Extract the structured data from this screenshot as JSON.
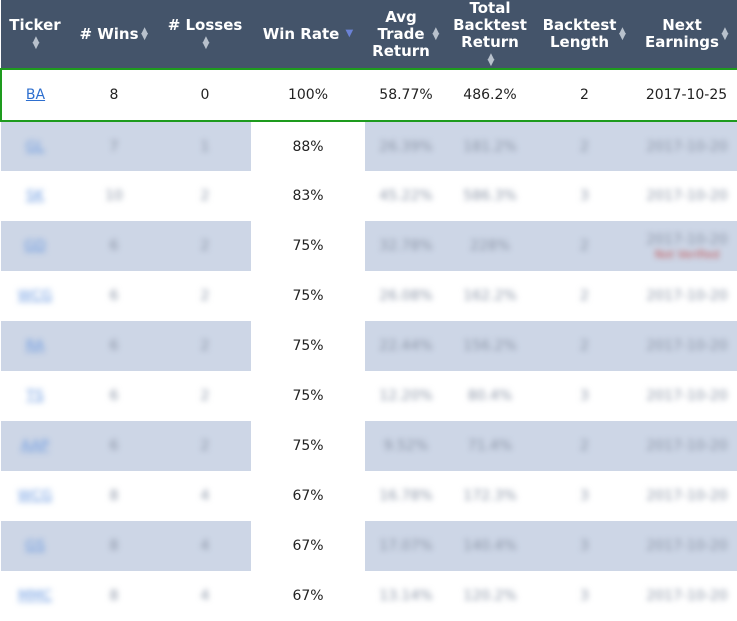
{
  "headers": [
    {
      "key": "ticker",
      "lines": [
        "Ticker"
      ]
    },
    {
      "key": "wins",
      "lines": [
        "# Wins"
      ]
    },
    {
      "key": "losses",
      "lines": [
        "# Losses"
      ]
    },
    {
      "key": "win_rate",
      "lines": [
        "Win Rate"
      ]
    },
    {
      "key": "avg_return",
      "lines": [
        "Avg",
        "Trade",
        "Return"
      ]
    },
    {
      "key": "total_return",
      "lines": [
        "Total",
        "Backtest",
        "Return"
      ]
    },
    {
      "key": "length",
      "lines": [
        "Backtest",
        "Length"
      ]
    },
    {
      "key": "earnings",
      "lines": [
        "Next",
        "Earnings"
      ]
    }
  ],
  "sort_icon": "sort-arrows-icon",
  "sorted_desc_icon": "sort-desc-triangle-icon",
  "rows": [
    {
      "ticker": "BA",
      "wins": "8",
      "losses": "0",
      "win_rate": "100%",
      "avg_return": "58.77%",
      "total_return": "486.2%",
      "length": "2",
      "earnings": "2017-10-25",
      "blurred": false
    },
    {
      "ticker": "GL",
      "wins": "7",
      "losses": "1",
      "win_rate": "88%",
      "avg_return": "26.39%",
      "total_return": "181.2%",
      "length": "2",
      "earnings": "2017-10-20",
      "blurred": true
    },
    {
      "ticker": "SK",
      "wins": "10",
      "losses": "2",
      "win_rate": "83%",
      "avg_return": "45.22%",
      "total_return": "586.3%",
      "length": "3",
      "earnings": "2017-10-20",
      "blurred": true
    },
    {
      "ticker": "GD",
      "wins": "6",
      "losses": "2",
      "win_rate": "75%",
      "avg_return": "32.78%",
      "total_return": "228%",
      "length": "2",
      "earnings": "2017-10-20",
      "earnings_note": "Not Verified",
      "blurred": true
    },
    {
      "ticker": "WCG",
      "wins": "6",
      "losses": "2",
      "win_rate": "75%",
      "avg_return": "26.08%",
      "total_return": "162.2%",
      "length": "2",
      "earnings": "2017-10-20",
      "blurred": true
    },
    {
      "ticker": "RA",
      "wins": "6",
      "losses": "2",
      "win_rate": "75%",
      "avg_return": "22.44%",
      "total_return": "156.2%",
      "length": "2",
      "earnings": "2017-10-20",
      "blurred": true
    },
    {
      "ticker": "TS",
      "wins": "6",
      "losses": "2",
      "win_rate": "75%",
      "avg_return": "12.20%",
      "total_return": "80.4%",
      "length": "3",
      "earnings": "2017-10-20",
      "blurred": true
    },
    {
      "ticker": "AAP",
      "wins": "6",
      "losses": "2",
      "win_rate": "75%",
      "avg_return": "9.52%",
      "total_return": "71.4%",
      "length": "2",
      "earnings": "2017-10-20",
      "blurred": true
    },
    {
      "ticker": "WCG",
      "wins": "8",
      "losses": "4",
      "win_rate": "67%",
      "avg_return": "16.78%",
      "total_return": "172.3%",
      "length": "3",
      "earnings": "2017-10-20",
      "blurred": true
    },
    {
      "ticker": "GS",
      "wins": "8",
      "losses": "4",
      "win_rate": "67%",
      "avg_return": "17.07%",
      "total_return": "140.4%",
      "length": "3",
      "earnings": "2017-10-20",
      "blurred": true
    },
    {
      "ticker": "MMC",
      "wins": "8",
      "losses": "4",
      "win_rate": "67%",
      "avg_return": "13.14%",
      "total_return": "120.2%",
      "length": "3",
      "earnings": "2017-10-20",
      "blurred": true
    }
  ],
  "colors": {
    "header_bg": "#44546a",
    "stripe": "#cdd6e6",
    "highlight_border": "#1e9b1e",
    "link": "#2e6fcf"
  }
}
